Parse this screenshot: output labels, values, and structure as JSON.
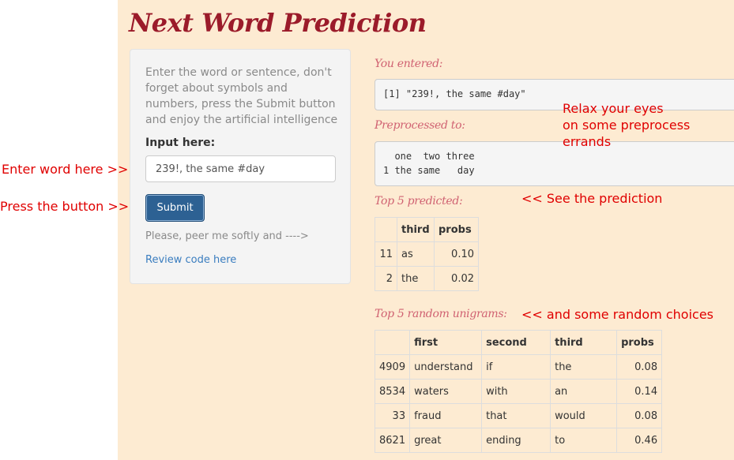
{
  "app": {
    "title": "Next Word Prediction"
  },
  "sidebar": {
    "instructions": "Enter the word or sentence, don't forget about symbols and numbers, press the Submit button and enjoy the artificial intelligence",
    "input_label": "Input here:",
    "input_value": "239!, the same #day",
    "submit_label": "Submit",
    "peer_text": "Please, peer me softly and ---->",
    "review_link": "Review code here"
  },
  "main": {
    "entered_heading": "You entered:",
    "entered_output": "[1] \"239!, the same #day\"",
    "preprocessed_heading": "Preprocessed to:",
    "preprocessed_output": "  one  two three\n1 the same   day",
    "predicted_heading": "Top 5 predicted:",
    "predicted_table": {
      "columns": [
        "",
        "third",
        "probs"
      ],
      "rows": [
        [
          "11",
          "as",
          "0.10"
        ],
        [
          "2",
          "the",
          "0.02"
        ]
      ]
    },
    "random_heading": "Top 5 random unigrams:",
    "random_table": {
      "columns": [
        "",
        "first",
        "second",
        "third",
        "probs"
      ],
      "rows": [
        [
          "4909",
          "understand",
          "if",
          "the",
          "0.08"
        ],
        [
          "8534",
          "waters",
          "with",
          "an",
          "0.14"
        ],
        [
          "33",
          "fraud",
          "that",
          "would",
          "0.08"
        ],
        [
          "8621",
          "great",
          "ending",
          "to",
          "0.46"
        ]
      ]
    }
  },
  "annotations": {
    "enter_word": "Enter word here >>",
    "press_button": "Press the button >>",
    "relax": "Relax your eyes\non some preprocess\nerrands",
    "see_prediction": "<< See the prediction",
    "random_choices": "<< and some random choices"
  },
  "colors": {
    "accent": "#9b1b2a",
    "section_heading": "#d06272",
    "annotation": "#e00000",
    "background": "#fdebd2",
    "button": "#2d6193",
    "link": "#3a7dbf"
  }
}
